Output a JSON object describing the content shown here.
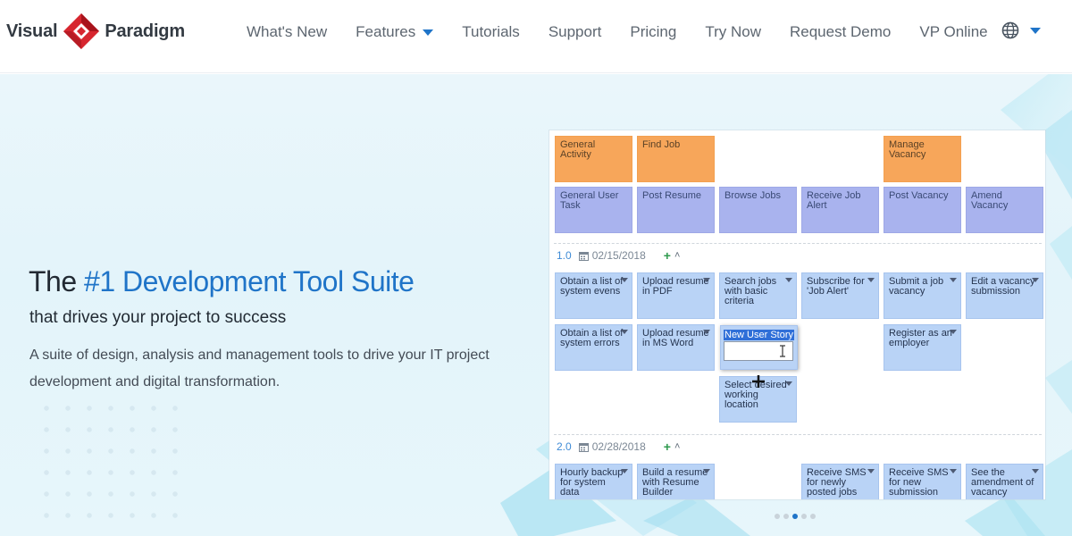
{
  "brand": {
    "word_left": "Visual",
    "word_right": "Paradigm",
    "colors": {
      "logo_red": "#d7262f",
      "logo_dark_red": "#a8131c",
      "accent_blue": "#1f74c8"
    }
  },
  "nav": {
    "items": [
      {
        "label": "What's New",
        "has_dropdown": false
      },
      {
        "label": "Features",
        "has_dropdown": true
      },
      {
        "label": "Tutorials",
        "has_dropdown": false
      },
      {
        "label": "Support",
        "has_dropdown": false
      },
      {
        "label": "Pricing",
        "has_dropdown": false
      },
      {
        "label": "Try Now",
        "has_dropdown": false
      },
      {
        "label": "Request Demo",
        "has_dropdown": false
      },
      {
        "label": "VP Online",
        "has_dropdown": false
      }
    ],
    "language_icon": "globe-icon"
  },
  "hero": {
    "title_prefix": "The ",
    "title_highlight": "#1 Development Tool Suite",
    "subtitle": "that drives your project to success",
    "description": "A suite of design, analysis and management tools to drive your IT project development and digital transformation."
  },
  "board": {
    "activities": [
      {
        "col": 0,
        "text": "General Activity"
      },
      {
        "col": 1,
        "text": "Find Job"
      },
      {
        "col": 4,
        "text": "Manage Vacancy"
      }
    ],
    "tasks": [
      {
        "col": 0,
        "text": "General User Task"
      },
      {
        "col": 1,
        "text": "Post Resume"
      },
      {
        "col": 2,
        "text": "Browse Jobs"
      },
      {
        "col": 3,
        "text": "Receive Job Alert"
      },
      {
        "col": 4,
        "text": "Post Vacancy"
      },
      {
        "col": 5,
        "text": "Amend Vacancy"
      }
    ],
    "releases": [
      {
        "version": "1.0",
        "date": "02/15/2018",
        "stories": [
          {
            "col": 0,
            "row": 0,
            "text": "Obtain a list of system evens"
          },
          {
            "col": 1,
            "row": 0,
            "text": "Upload resume in PDF"
          },
          {
            "col": 2,
            "row": 0,
            "text": "Search jobs with basic criteria"
          },
          {
            "col": 3,
            "row": 0,
            "text": "Subscribe for 'Job Alert'"
          },
          {
            "col": 4,
            "row": 0,
            "text": "Submit a job vacancy"
          },
          {
            "col": 5,
            "row": 0,
            "text": "Edit a vacancy submission"
          },
          {
            "col": 0,
            "row": 1,
            "text": "Obtain a list of system errors"
          },
          {
            "col": 1,
            "row": 1,
            "text": "Upload resume in MS Word"
          },
          {
            "col": 4,
            "row": 1,
            "text": "Register as an employer"
          },
          {
            "col": 2,
            "row": 2,
            "text": "Select desired working location"
          }
        ]
      },
      {
        "version": "2.0",
        "date": "02/28/2018",
        "stories": [
          {
            "col": 0,
            "row": 0,
            "text": "Hourly backup for system data"
          },
          {
            "col": 1,
            "row": 0,
            "text": "Build a resume with Resume Builder"
          },
          {
            "col": 3,
            "row": 0,
            "text": "Receive SMS for newly posted jobs"
          },
          {
            "col": 4,
            "row": 0,
            "text": "Receive SMS for new submission"
          },
          {
            "col": 5,
            "row": 0,
            "text": "See the amendment of vacancy"
          }
        ]
      }
    ],
    "editing_card_label": "New User Story"
  },
  "carousel": {
    "slide_count": 5,
    "active_index": 2
  }
}
